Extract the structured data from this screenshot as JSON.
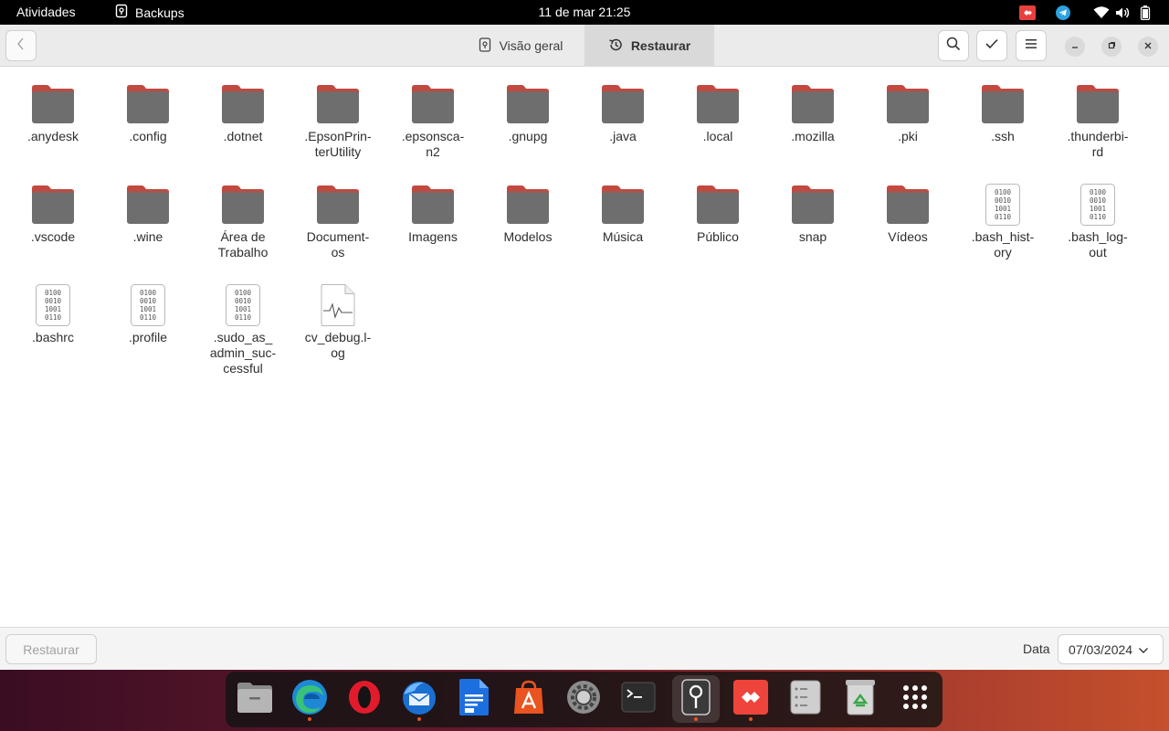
{
  "topbar": {
    "activities": "Atividades",
    "app_name": "Backups",
    "clock": "11 de mar  21:25"
  },
  "headerbar": {
    "tabs": [
      {
        "label": "Visão geral",
        "icon": "safe-icon"
      },
      {
        "label": "Restaurar",
        "icon": "history-icon",
        "selected": true
      }
    ]
  },
  "files": [
    {
      "name": ".anydesk",
      "type": "folder"
    },
    {
      "name": ".config",
      "type": "folder"
    },
    {
      "name": ".dotnet",
      "type": "folder"
    },
    {
      "name": ".EpsonPrin-\nterUtility",
      "type": "folder"
    },
    {
      "name": ".epsonsca-\nn2",
      "type": "folder"
    },
    {
      "name": ".gnupg",
      "type": "folder"
    },
    {
      "name": ".java",
      "type": "folder"
    },
    {
      "name": ".local",
      "type": "folder"
    },
    {
      "name": ".mozilla",
      "type": "folder"
    },
    {
      "name": ".pki",
      "type": "folder"
    },
    {
      "name": ".ssh",
      "type": "folder"
    },
    {
      "name": ".thunderbi-\nrd",
      "type": "folder"
    },
    {
      "name": ".vscode",
      "type": "folder"
    },
    {
      "name": ".wine",
      "type": "folder"
    },
    {
      "name": "Área de\nTrabalho",
      "type": "folder"
    },
    {
      "name": "Document-\nos",
      "type": "folder"
    },
    {
      "name": "Imagens",
      "type": "folder"
    },
    {
      "name": "Modelos",
      "type": "folder"
    },
    {
      "name": "Música",
      "type": "folder"
    },
    {
      "name": "Público",
      "type": "folder"
    },
    {
      "name": "snap",
      "type": "folder"
    },
    {
      "name": "Vídeos",
      "type": "folder"
    },
    {
      "name": ".bash_hist-\nory",
      "type": "binary"
    },
    {
      "name": ".bash_log-\nout",
      "type": "binary"
    },
    {
      "name": ".bashrc",
      "type": "binary"
    },
    {
      "name": ".profile",
      "type": "binary"
    },
    {
      "name": ".sudo_as_\nadmin_suc-\ncessful",
      "type": "binary"
    },
    {
      "name": "cv_debug.l-\nog",
      "type": "log"
    }
  ],
  "bottombar": {
    "restore_label": "Restaurar",
    "date_label": "Data",
    "date_value": "07/03/2024"
  },
  "dock": [
    {
      "name": "files-app-icon",
      "running": false
    },
    {
      "name": "edge-browser-icon",
      "running": true
    },
    {
      "name": "opera-browser-icon",
      "running": false
    },
    {
      "name": "thunderbird-icon",
      "running": true
    },
    {
      "name": "writer-icon",
      "running": false
    },
    {
      "name": "app-center-icon",
      "running": false
    },
    {
      "name": "settings-icon",
      "running": false
    },
    {
      "name": "terminal-icon",
      "running": false
    },
    {
      "name": "backups-icon",
      "running": true,
      "active": true
    },
    {
      "name": "anydesk-icon",
      "running": true
    },
    {
      "name": "file-manager-alt-icon",
      "running": false
    },
    {
      "name": "trash-icon",
      "running": false
    },
    {
      "name": "show-apps-icon",
      "running": false
    }
  ],
  "colors": {
    "folder_tab": "#c2493f",
    "folder_body": "#6e6e6e",
    "accent": "#e95420"
  }
}
